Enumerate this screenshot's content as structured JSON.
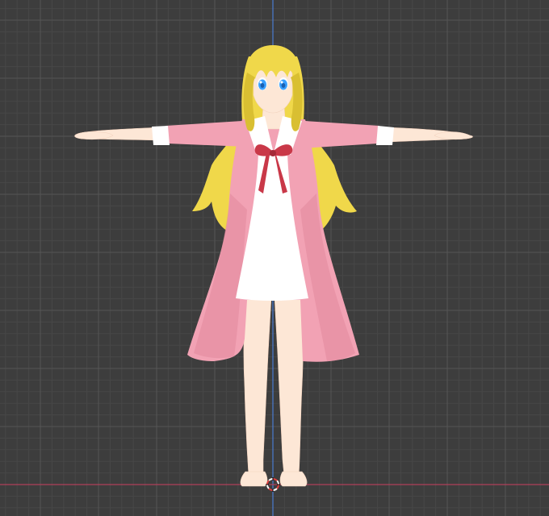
{
  "viewport": {
    "mode": "front-orthographic",
    "background_color": "#3d3d3d",
    "grid": {
      "minor_color": "#474747",
      "major_color": "#555555",
      "visible": true
    },
    "axes": {
      "vertical_axis_color": "#4a7bd1",
      "horizontal_axis_color": "#b0405a"
    },
    "origin_cursor": {
      "icon": "3d-cursor-icon",
      "ring_color_a": "#e04040",
      "ring_color_b": "#ffffff"
    }
  },
  "model": {
    "pose": "t-pose",
    "palette": {
      "hair": "#f0d84a",
      "hair_shadow": "#d9bf32",
      "skin": "#fde7d6",
      "skin_shadow": "#f3d3bf",
      "coat": "#f2a2b4",
      "coat_shadow": "#e2889c",
      "dress": "#ffffff",
      "collar": "#ffffff",
      "ribbon": "#c93848",
      "ribbon_shadow": "#a52a38",
      "eyes": "#3aa0ff",
      "eye_dark": "#1a5fb0",
      "cuffs": "#ffffff"
    }
  }
}
